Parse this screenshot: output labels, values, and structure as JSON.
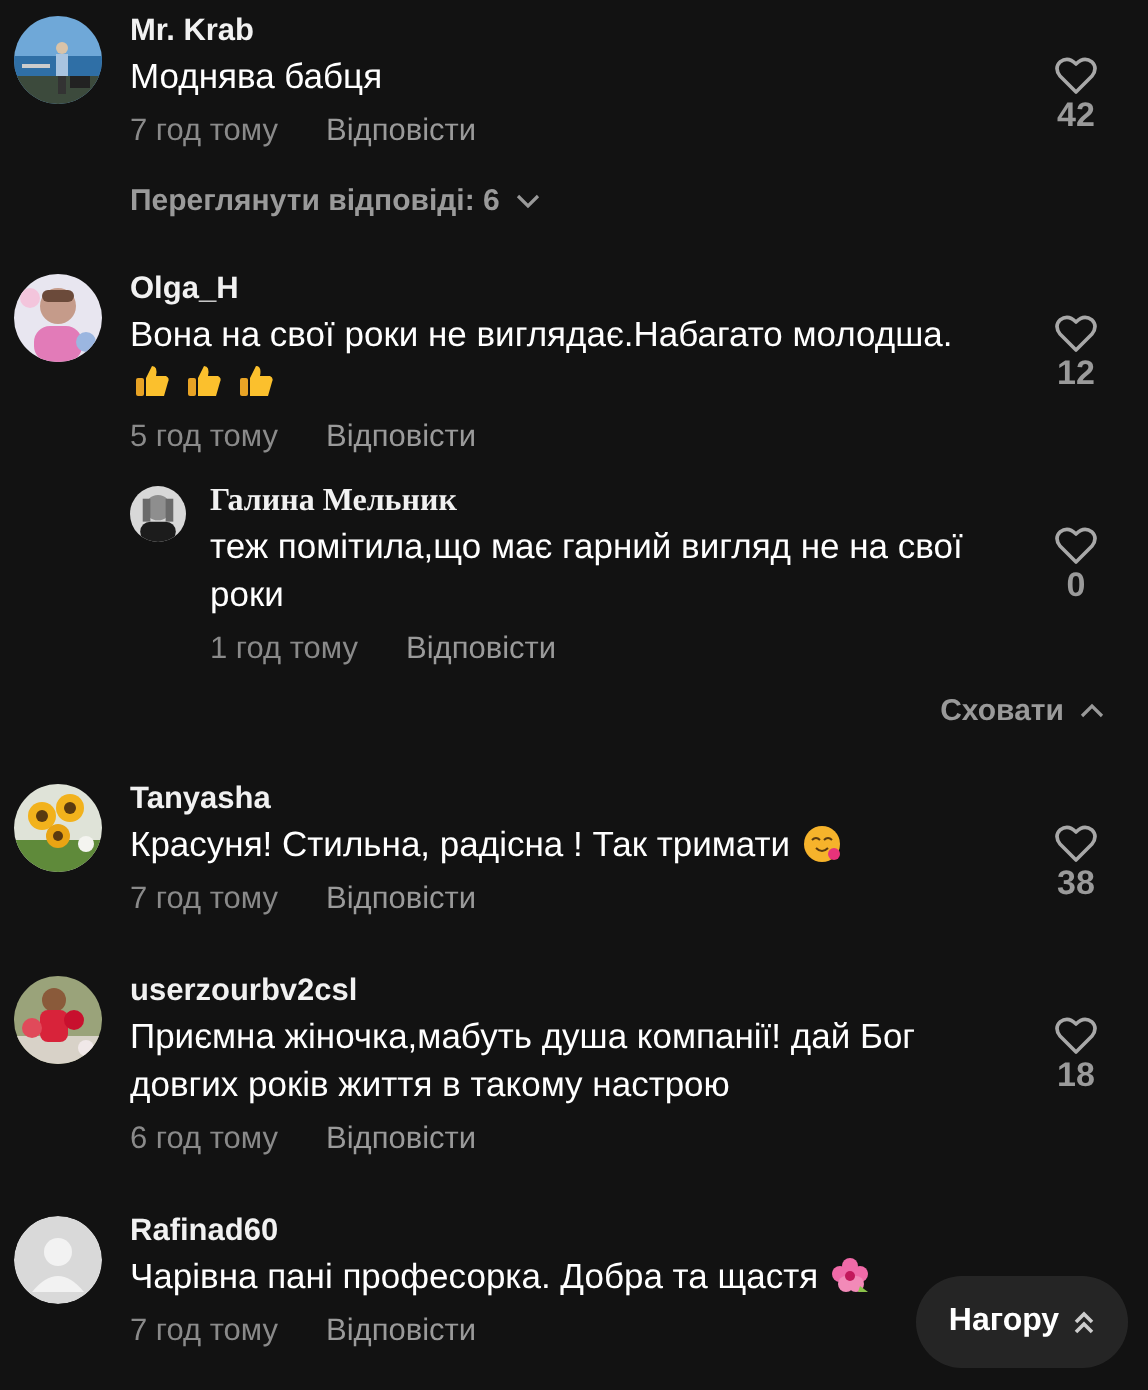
{
  "comments": [
    {
      "author": "Mr. Krab",
      "text": "Моднява бабця",
      "time": "7 год тому",
      "reply_label": "Відповісти",
      "likes": "42",
      "replies_toggle": {
        "label": "Переглянути відповіді: 6",
        "expanded": false
      }
    },
    {
      "author": "Olga_H",
      "text": "Вона на свої роки не виглядає.Набагато молодша.",
      "emojis": [
        {
          "kind": "thumbs"
        },
        {
          "kind": "thumbs"
        },
        {
          "kind": "thumbs"
        }
      ],
      "time": "5 год тому",
      "reply_label": "Відповісти",
      "likes": "12",
      "replies": [
        {
          "author": "Галина Мельник",
          "text": "теж помітила,що має гарний вигляд не на свої роки",
          "time": "1 год тому",
          "reply_label": "Відповісти",
          "likes": "0"
        }
      ],
      "replies_toggle": {
        "label": "Сховати",
        "expanded": true
      }
    },
    {
      "author": "Tanyasha",
      "text": "Красуня! Стильна, радісна ! Так тримати",
      "emojis": [
        {
          "kind": "smile-hearts"
        }
      ],
      "time": "7 год тому",
      "reply_label": "Відповісти",
      "likes": "38"
    },
    {
      "author": "userzourbv2csl",
      "text": "Приємна жіночка,мабуть душа компанії! дай Бог довгих років життя в такому настрою",
      "time": "6 год тому",
      "reply_label": "Відповісти",
      "likes": "18"
    },
    {
      "author": "Rafinad60",
      "avatar": {
        "kind": "default"
      },
      "text": "Чарівна пані професорка. Добра та щастя",
      "emojis": [
        {
          "kind": "flower"
        }
      ],
      "time": "7 год тому",
      "reply_label": "Відповісти"
    }
  ],
  "scroll_top_button": {
    "label": "Нагору"
  }
}
